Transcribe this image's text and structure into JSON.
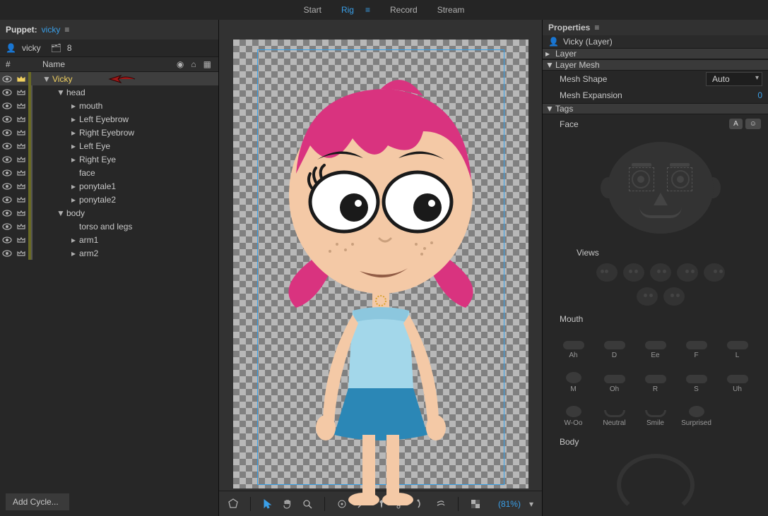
{
  "tabs": {
    "start": "Start",
    "rig": "Rig",
    "record": "Record",
    "stream": "Stream"
  },
  "left": {
    "panel_title": "Puppet:",
    "panel_link": "vicky",
    "sub_name": "vicky",
    "layer_count": "8",
    "col_sharp": "#",
    "col_name": "Name",
    "add_cycle": "Add Cycle...",
    "layers": [
      {
        "name": "Vicky",
        "depth": 0,
        "sel": true,
        "twisty": "▼",
        "crown": true
      },
      {
        "name": "head",
        "depth": 1,
        "twisty": "▼",
        "crown": true
      },
      {
        "name": "mouth",
        "depth": 2,
        "twisty": "▸",
        "crown": true
      },
      {
        "name": "Left Eyebrow",
        "depth": 2,
        "twisty": "▸",
        "crown": true
      },
      {
        "name": "Right Eyebrow",
        "depth": 2,
        "twisty": "▸",
        "crown": true
      },
      {
        "name": "Left Eye",
        "depth": 2,
        "twisty": "▸",
        "crown": true
      },
      {
        "name": "Right Eye",
        "depth": 2,
        "twisty": "▸",
        "crown": true
      },
      {
        "name": "face",
        "depth": 2,
        "twisty": "",
        "crown": true
      },
      {
        "name": "ponytale1",
        "depth": 2,
        "twisty": "▸",
        "crown": true
      },
      {
        "name": "ponytale2",
        "depth": 2,
        "twisty": "▸",
        "crown": true
      },
      {
        "name": "body",
        "depth": 1,
        "twisty": "▼",
        "crown": true
      },
      {
        "name": "torso and legs",
        "depth": 2,
        "twisty": "",
        "crown": true
      },
      {
        "name": "arm1",
        "depth": 2,
        "twisty": "▸",
        "crown": true
      },
      {
        "name": "arm2",
        "depth": 2,
        "twisty": "▸",
        "crown": true
      }
    ]
  },
  "center": {
    "zoom": "(81%)"
  },
  "right": {
    "panel_title": "Properties",
    "layer_title": "Vicky (Layer)",
    "sections": {
      "layer": "Layer",
      "layer_mesh": "Layer Mesh",
      "tags": "Tags"
    },
    "mesh_shape_k": "Mesh Shape",
    "mesh_shape_v": "Auto",
    "mesh_exp_k": "Mesh Expansion",
    "mesh_exp_v": "0",
    "face_label": "Face",
    "face_btn_a": "A",
    "views_label": "Views",
    "mouth_label": "Mouth",
    "body_label": "Body",
    "visemes": [
      "Ah",
      "D",
      "Ee",
      "F",
      "L",
      "M",
      "Oh",
      "R",
      "S",
      "Uh",
      "W-Oo",
      "Neutral",
      "Smile",
      "Surprised"
    ]
  },
  "colors": {
    "hair": "#d9337f",
    "skin": "#f4c9a6",
    "shirt": "#a3d7ea",
    "skirt": "#2b87b6",
    "accent": "#3a9fe8"
  }
}
